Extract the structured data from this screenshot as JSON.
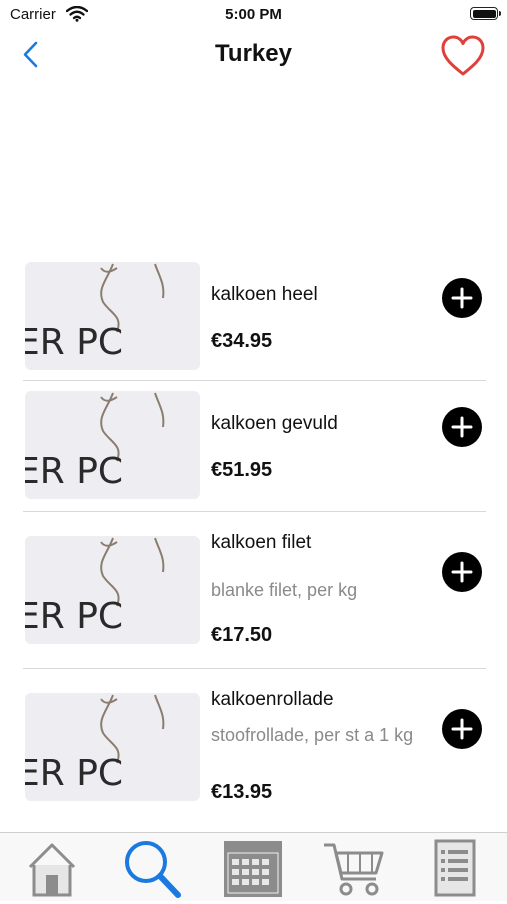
{
  "status_bar": {
    "carrier": "Carrier",
    "time": "5:00 PM"
  },
  "nav": {
    "title": "Turkey"
  },
  "products": [
    {
      "name": "kalkoen heel",
      "description": "",
      "price": "€34.95",
      "image_text": "ER  PC"
    },
    {
      "name": "kalkoen gevuld",
      "description": "",
      "price": "€51.95",
      "image_text": "ER  PC"
    },
    {
      "name": "kalkoen filet",
      "description": "blanke filet, per kg",
      "price": "€17.50",
      "image_text": "ER  PC"
    },
    {
      "name": "kalkoenrollade",
      "description": "stoofrollade, per st a 1 kg",
      "price": "€13.95",
      "image_text": "ER  PC"
    }
  ],
  "tabs": [
    {
      "icon": "home-icon",
      "active": false
    },
    {
      "icon": "search-icon",
      "active": true
    },
    {
      "icon": "calendar-icon",
      "active": false
    },
    {
      "icon": "cart-icon",
      "active": false
    },
    {
      "icon": "list-icon",
      "active": false
    }
  ],
  "colors": {
    "accent": "#1a7ae0",
    "favorite": "#e0403a",
    "inactive_tab": "#8c8c8c"
  }
}
